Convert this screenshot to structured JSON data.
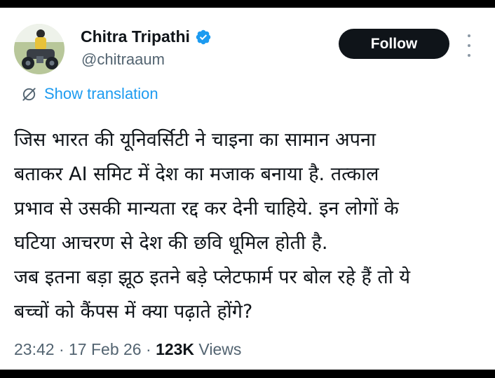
{
  "colors": {
    "accent": "#1d9bf0",
    "text_primary": "#0f1419",
    "text_secondary": "#536471",
    "follow_button_bg": "#0f1419",
    "follow_button_text": "#ffffff",
    "verified_badge": "#1d9bf0",
    "frame_bg": "#000000"
  },
  "author": {
    "display_name": "Chitra Tripathi",
    "handle": "@chitraaum",
    "verified_icon": "verified-badge-icon",
    "avatar_icon": "avatar-photo"
  },
  "header": {
    "follow_label": "Follow",
    "more_icon": "more-vertical-icon"
  },
  "translation": {
    "label": "Show translation",
    "icon": "globe-slash-icon"
  },
  "tweet": {
    "lines": [
      "जिस भारत की यूनिवर्सिटी ने चाइना का सामान अपना",
      "बताकर AI समिट में देश का मजाक बनाया है. तत्काल",
      "प्रभाव से उसकी मान्यता रद्द कर देनी चाहिये. इन लोगों के",
      "घटिया आचरण से देश की छवि धूमिल होती है.",
      "जब इतना बड़ा झूठ इतने बड़े प्लेटफार्म पर बोल रहे हैं तो ये",
      "बच्चों को कैंपस में क्या पढ़ाते होंगे?"
    ]
  },
  "meta": {
    "time": "23:42",
    "separator": " · ",
    "date": "17 Feb 26",
    "views_count": "123K",
    "views_label": " Views"
  }
}
